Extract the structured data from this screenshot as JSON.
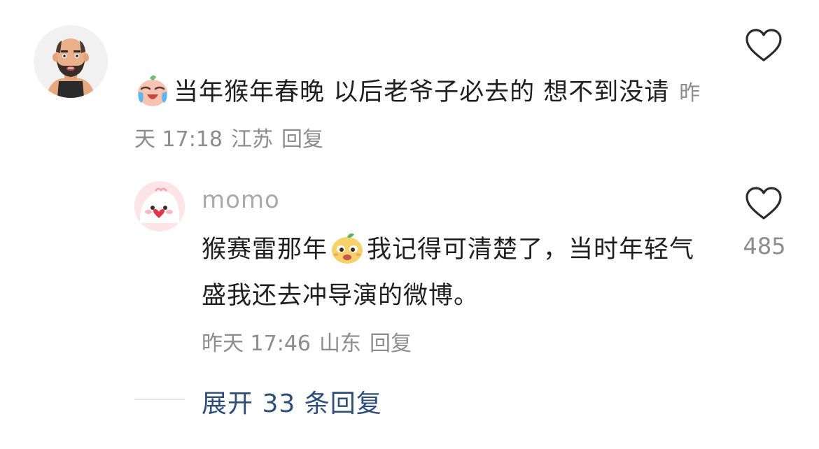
{
  "comment": {
    "text": "当年猴年春晚 以后老爷子必去的 想不到没请",
    "time": "昨天 17:18",
    "location": "江苏",
    "reply_label": "回复",
    "emoji_icon": "crying-laughing-emoji-icon",
    "like_icon": "heart-outline-icon"
  },
  "reply": {
    "username": "momo",
    "text_before_emoji": "猴赛雷那年",
    "text_after_emoji": "我记得可清楚了，当时年轻气盛我还去冲导演的微博。",
    "emoji_icon": "smug-face-emoji-icon",
    "time": "昨天 17:46",
    "location": "山东",
    "reply_label": "回复",
    "like_count": "485",
    "like_icon": "heart-outline-icon"
  },
  "expand": {
    "label": "展开 33 条回复"
  },
  "colors": {
    "text": "#1f1f1f",
    "meta": "#8c8c8c",
    "username": "#a9a9a9",
    "link": "#2e4d7a"
  }
}
